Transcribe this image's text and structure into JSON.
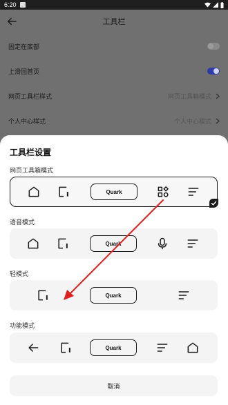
{
  "status_bar": {
    "time": "6:20"
  },
  "background_page": {
    "title": "工具栏",
    "rows": [
      {
        "label": "固定在底部",
        "toggle": "off"
      },
      {
        "label": "上滑回首页",
        "toggle": "on"
      },
      {
        "label": "网页工具栏样式",
        "value": "网页工具箱模式"
      },
      {
        "label": "个人中心样式",
        "value": "个人中心模式"
      }
    ]
  },
  "sheet": {
    "title": "工具栏设置",
    "sections": [
      {
        "label": "网页工具箱模式",
        "selected": true,
        "items": [
          "home-icon",
          "tabs-icon",
          "Quark",
          "grid-icon",
          "menu-icon"
        ]
      },
      {
        "label": "语音模式",
        "selected": false,
        "items": [
          "home-icon",
          "tabs-icon",
          "Quark",
          "microphone-icon",
          "menu-icon"
        ]
      },
      {
        "label": "轻模式",
        "selected": false,
        "items": [
          "tabs-icon",
          "Quark",
          "menu-icon"
        ]
      },
      {
        "label": "功能模式",
        "selected": false,
        "items": [
          "back-arrow-icon",
          "tabs-icon",
          "Quark",
          "menu-icon",
          "home-icon"
        ]
      }
    ],
    "quark_label": "Quark",
    "cancel_label": "取消"
  },
  "colors": {
    "annotation_arrow": "#e02020",
    "toggle_on": "#2d3aa8"
  }
}
